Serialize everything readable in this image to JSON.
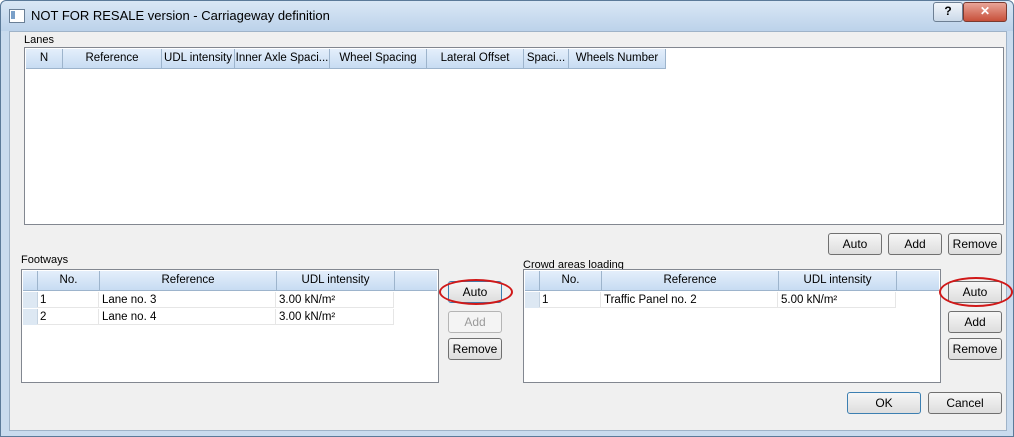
{
  "window": {
    "title": "NOT FOR RESALE version - Carriageway definition",
    "help_label": "?",
    "close_label": "✕"
  },
  "lanes": {
    "label": "Lanes",
    "columns": [
      "N",
      "Reference",
      "UDL intensity",
      "Inner Axle Spaci...",
      "Wheel Spacing",
      "Lateral Offset",
      "Spaci...",
      "Wheels Number"
    ],
    "buttons": {
      "auto": "Auto",
      "add": "Add",
      "remove": "Remove"
    }
  },
  "footways": {
    "label": "Footways",
    "columns": [
      "No.",
      "Reference",
      "UDL intensity"
    ],
    "rows": [
      {
        "no": "1",
        "reference": "Lane no. 3",
        "udl": "3.00 kN/m²"
      },
      {
        "no": "2",
        "reference": "Lane no. 4",
        "udl": "3.00 kN/m²"
      }
    ],
    "buttons": {
      "auto": "Auto",
      "add": "Add",
      "remove": "Remove"
    }
  },
  "crowd": {
    "label": "Crowd areas loading",
    "columns": [
      "No.",
      "Reference",
      "UDL intensity"
    ],
    "rows": [
      {
        "no": "1",
        "reference": "Traffic Panel no. 2",
        "udl": "5.00 kN/m²"
      }
    ],
    "buttons": {
      "auto": "Auto",
      "add": "Add",
      "remove": "Remove"
    }
  },
  "dialog": {
    "ok": "OK",
    "cancel": "Cancel"
  }
}
